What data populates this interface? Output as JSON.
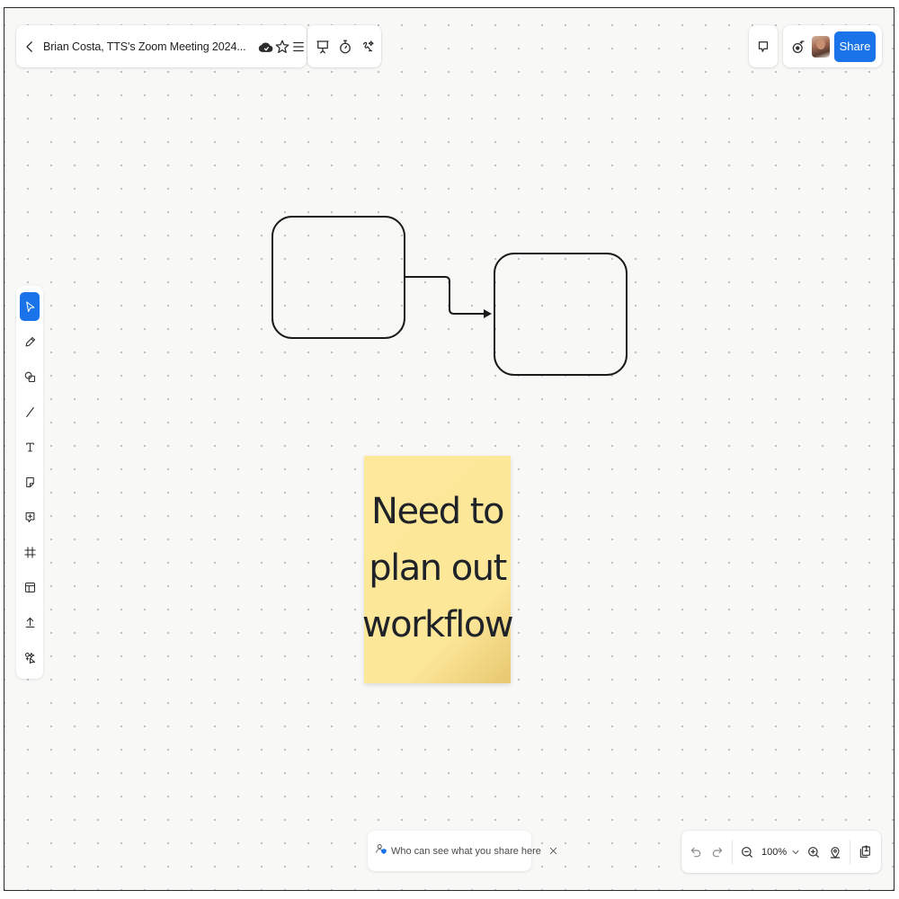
{
  "header": {
    "board_title": "Brian Costa, TTS's Zoom Meeting 2024...",
    "share_label": "Share"
  },
  "icons": {
    "back": "chevron-left-icon",
    "cloud_status": "cloud-sync-icon",
    "star": "star-icon",
    "menu": "hamburger-menu-icon",
    "present": "presentation-icon",
    "timer": "timer-icon",
    "draw_ai": "smart-draw-icon",
    "comment": "comment-icon",
    "reactions": "reactions-icon"
  },
  "left_toolbar": {
    "tools": [
      {
        "name": "select",
        "icon": "cursor-icon",
        "active": true
      },
      {
        "name": "pen",
        "icon": "pen-icon",
        "active": false
      },
      {
        "name": "shapes",
        "icon": "shapes-icon",
        "active": false
      },
      {
        "name": "line",
        "icon": "line-icon",
        "active": false
      },
      {
        "name": "text",
        "icon": "text-icon",
        "active": false
      },
      {
        "name": "sticky-note",
        "icon": "sticky-note-icon",
        "active": false
      },
      {
        "name": "comment",
        "icon": "comment-add-icon",
        "active": false
      },
      {
        "name": "frame",
        "icon": "frame-icon",
        "active": false
      },
      {
        "name": "templates",
        "icon": "template-icon",
        "active": false
      },
      {
        "name": "upload",
        "icon": "upload-icon",
        "active": false
      },
      {
        "name": "more-apps",
        "icon": "apps-icon",
        "active": false
      }
    ]
  },
  "canvas": {
    "sticky_note": {
      "text": "Need to\nplan out\nworkflow",
      "color": "#fde99b"
    },
    "stroke_color": "#1b1b1b"
  },
  "notice": {
    "text": "Who can see what you share here"
  },
  "zoom": {
    "value": "100%",
    "page_indicator": "1"
  },
  "colors": {
    "accent": "#1a73e8",
    "canvas_bg": "#f8f8f6"
  }
}
